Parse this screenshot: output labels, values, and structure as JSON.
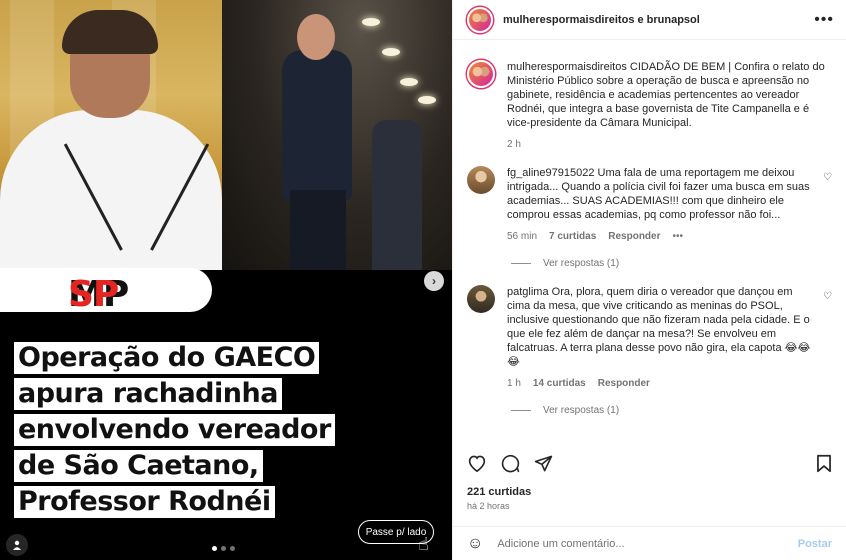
{
  "media": {
    "logo_mp": "MP",
    "logo_sp": "SP",
    "headline_lines": [
      "Operação do GAECO",
      "apura rachadinha",
      "envolvendo vereador",
      "de São Caetano,",
      "Professor Rodnéi"
    ],
    "swipe_label": "Passe p/ lado",
    "carousel_total": 3,
    "carousel_active": 1
  },
  "header": {
    "accounts": "mulherespormaisdireitos e brunapsol",
    "more": "•••"
  },
  "caption": {
    "username": "mulherespormaisdireitos",
    "text": "CIDADÃO DE BEM | Confira o relato do Ministério Público sobre a operação de busca e apreensão no gabinete, residência e academias pertencentes ao vereador Rodnéi, que integra a base governista de Tite Campanella e é vice-presidente da Câmara Municipal.",
    "time": "2 h"
  },
  "comments": [
    {
      "username": "fg_aline97915022",
      "text": "Uma fala de uma reportagem me deixou intrigada... Quando a polícia civil foi fazer uma busca em suas academias... SUAS ACADEMIAS!!! com que dinheiro ele comprou essas academias, pq como professor não foi...",
      "time": "56 min",
      "likes": "7 curtidas",
      "reply": "Responder",
      "more": "•••",
      "view_replies": "Ver respostas (1)"
    },
    {
      "username": "patglima",
      "text": "Ora, plora, quem diria o vereador que dançou em cima da mesa, que vive criticando as meninas do PSOL, inclusive questionando que não fizeram nada pela cidade. E o que ele fez além de dançar na mesa?! Se envolveu em falcatruas. A terra plana desse povo não gira, ela capota 😂😂😂",
      "time": "1 h",
      "likes": "14 curtidas",
      "reply": "Responder",
      "view_replies": "Ver respostas (1)"
    }
  ],
  "footer": {
    "likes": "221 curtidas",
    "posted": "há 2 horas",
    "comment_placeholder": "Adicione um comentário...",
    "post_label": "Postar"
  },
  "colors": {
    "brand_red": "#e52521",
    "post_disabled": "#a7cbf0",
    "muted": "#737373"
  }
}
